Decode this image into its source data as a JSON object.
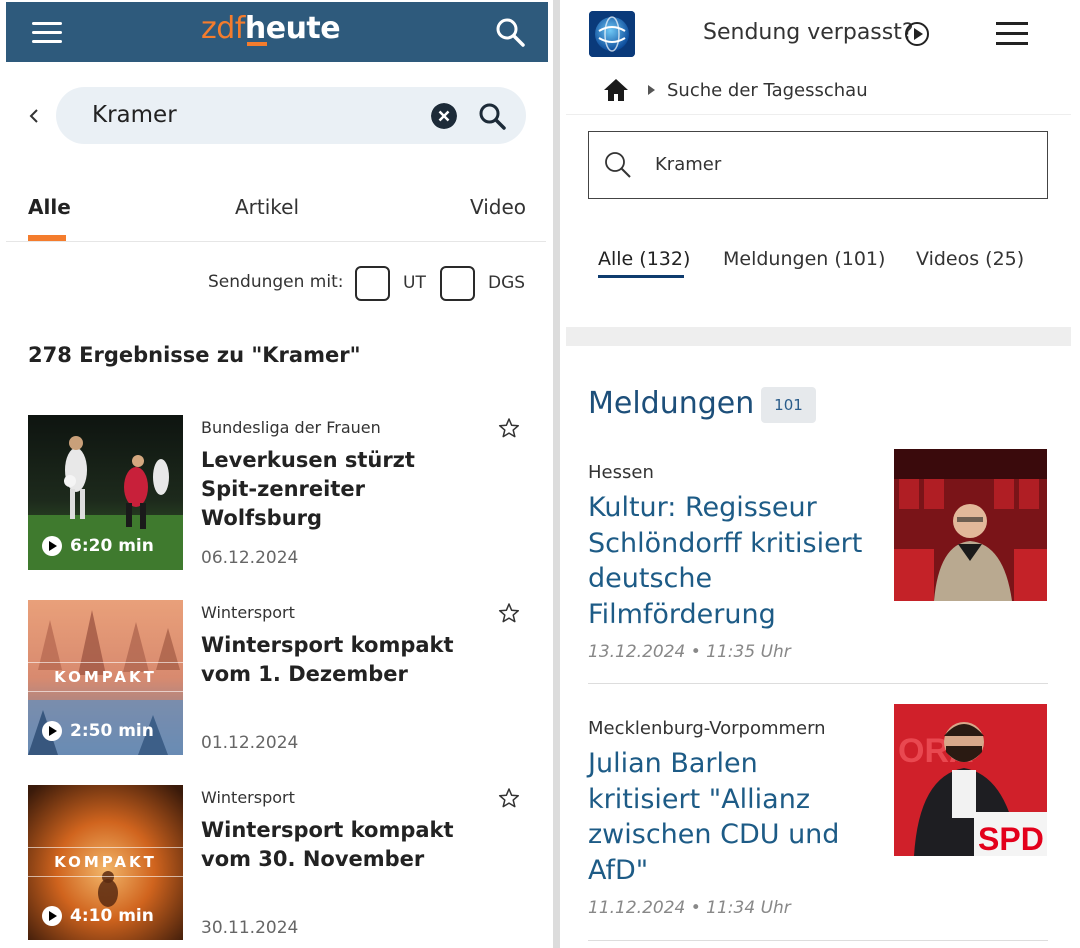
{
  "zdf": {
    "logo_part1": "zdf",
    "logo_part2": "heute",
    "search_value": "Kramer",
    "tabs": [
      "Alle",
      "Artikel",
      "Video"
    ],
    "filter_label": "Sendungen mit:",
    "filter_options": [
      "UT",
      "DGS"
    ],
    "results_title": "278 Ergebnisse zu \"Kramer\"",
    "items": [
      {
        "kicker": "Bundesliga der Frauen",
        "headline": "Leverkusen stürzt Spit-zenreiter Wolfsburg",
        "duration": "6:20 min",
        "date": "06.12.2024",
        "overlay": ""
      },
      {
        "kicker": "Wintersport",
        "headline": "Wintersport kompakt vom 1. Dezember",
        "duration": "2:50 min",
        "date": "01.12.2024",
        "overlay": "KOMPAKT"
      },
      {
        "kicker": "Wintersport",
        "headline": "Wintersport kompakt vom 30. November",
        "duration": "4:10 min",
        "date": "30.11.2024",
        "overlay": "KOMPAKT"
      }
    ]
  },
  "ts": {
    "verpasst": "Sendung verpasst?",
    "breadcrumb": "Suche der Tagesschau",
    "search_value": "Kramer",
    "tabs": [
      "Alle (132)",
      "Meldungen (101)",
      "Videos (25)"
    ],
    "section_title": "Meldungen",
    "section_count": "101",
    "items": [
      {
        "kicker": "Hessen",
        "headline": "Kultur: Regisseur Schlöndorff kritisiert deutsche Filmförderung",
        "date": "13.12.2024 • 11:35 Uhr"
      },
      {
        "kicker": "Mecklenburg-Vorpommern",
        "headline": "Julian Barlen kritisiert \"Allianz zwischen CDU und AfD\"",
        "date": "11.12.2024 • 11:34 Uhr",
        "image_text": "SPD"
      }
    ]
  },
  "colors": {
    "zdf_header": "#2e5a7c",
    "zdf_accent": "#f47c2d",
    "ts_link": "#1d5b86",
    "ts_dark": "#0f3c6e"
  },
  "icons": [
    "menu-icon",
    "search-icon",
    "back-chevron-icon",
    "clear-icon",
    "star-icon",
    "play-icon",
    "home-icon",
    "tagesschau-logo"
  ]
}
